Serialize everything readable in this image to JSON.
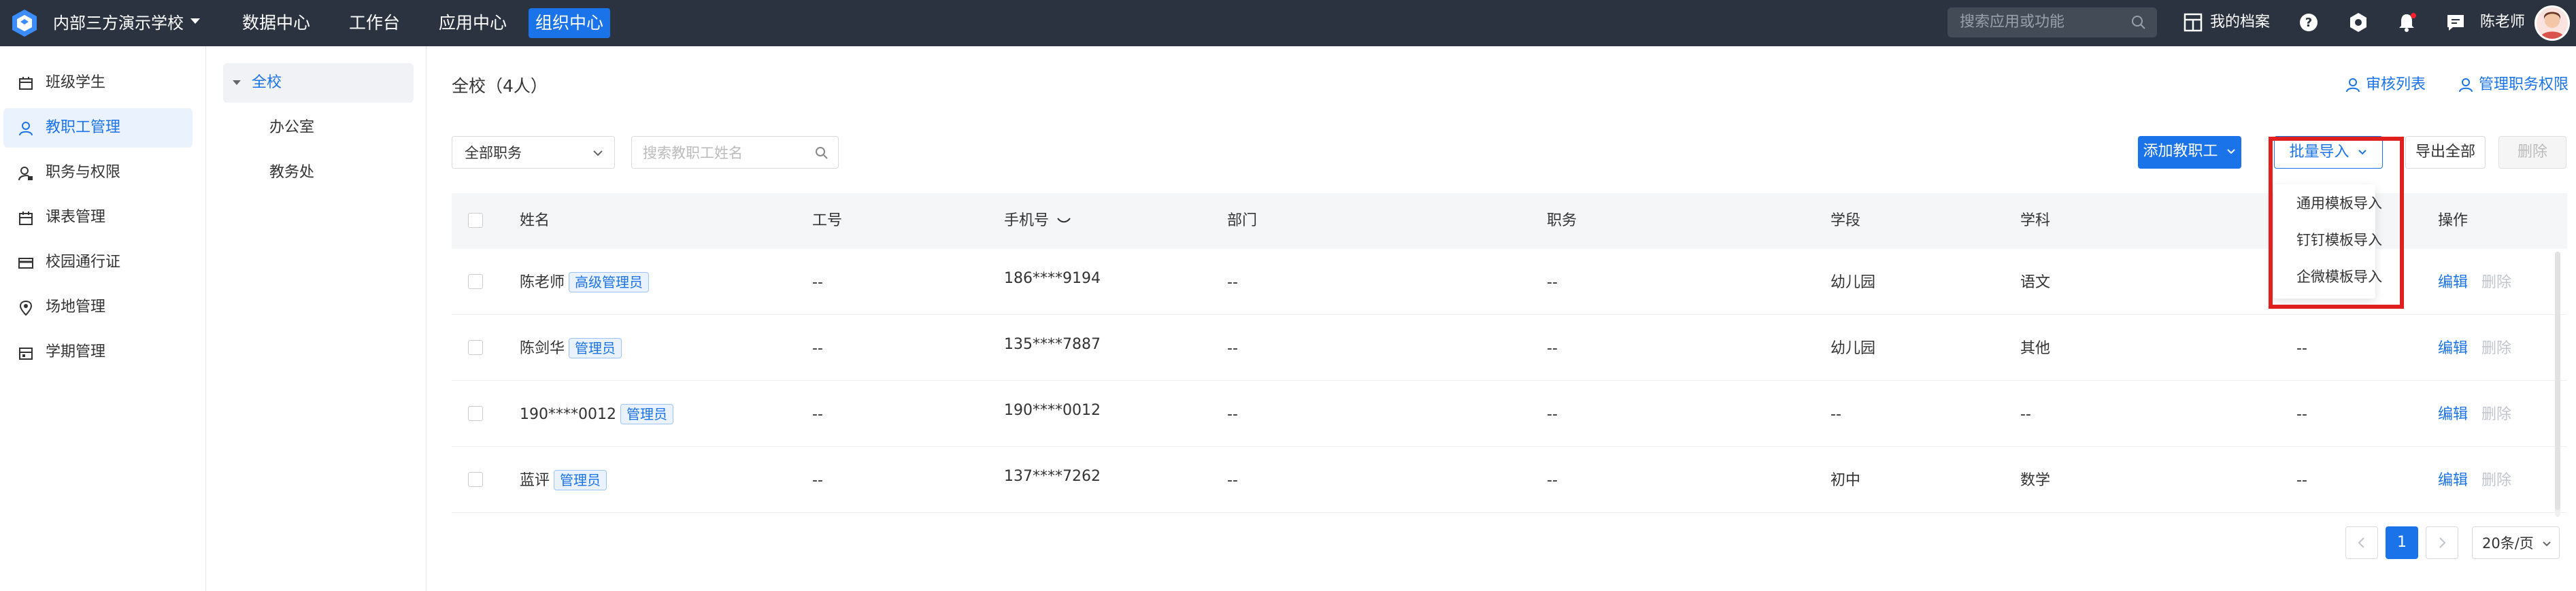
{
  "topbar": {
    "school_name": "内部三方演示学校",
    "nav": [
      "数据中心",
      "工作台",
      "应用中心",
      "组织中心"
    ],
    "search_placeholder": "搜索应用或功能",
    "my_profile": "我的档案",
    "user_name": "陈老师"
  },
  "sidebar": {
    "items": [
      {
        "label": "班级学生",
        "icon": "class-icon"
      },
      {
        "label": "教职工管理",
        "icon": "user-icon"
      },
      {
        "label": "职务与权限",
        "icon": "user-lock-icon"
      },
      {
        "label": "课表管理",
        "icon": "calendar-icon"
      },
      {
        "label": "校园通行证",
        "icon": "card-icon"
      },
      {
        "label": "场地管理",
        "icon": "location-icon"
      },
      {
        "label": "学期管理",
        "icon": "semester-icon"
      }
    ]
  },
  "tree": {
    "root": "全校",
    "children": [
      "办公室",
      "教务处"
    ]
  },
  "main": {
    "title": "全校（4人）",
    "review_list": "审核列表",
    "manage_permission": "管理职务权限",
    "role_filter": "全部职务",
    "search_placeholder": "搜索教职工姓名",
    "add_button": "添加教职工",
    "batch_import": "批量导入",
    "export_all": "导出全部",
    "delete": "删除"
  },
  "import_menu": [
    "通用模板导入",
    "钉钉模板导入",
    "企微模板导入"
  ],
  "table": {
    "columns": [
      "姓名",
      "工号",
      "手机号",
      "部门",
      "职务",
      "学段",
      "学科",
      "操作"
    ],
    "rows": [
      {
        "name": "陈老师",
        "tag": "高级管理员",
        "id": "--",
        "phone": "186****9194",
        "dept": "--",
        "position": "--",
        "stage": "幼儿园",
        "subject": "语文",
        "extra": "",
        "edit": "编辑",
        "del": "删除"
      },
      {
        "name": "陈剑华",
        "tag": "管理员",
        "id": "--",
        "phone": "135****7887",
        "dept": "--",
        "position": "--",
        "stage": "幼儿园",
        "subject": "其他",
        "extra": "--",
        "edit": "编辑",
        "del": "删除"
      },
      {
        "name": "190****0012",
        "tag": "管理员",
        "id": "--",
        "phone": "190****0012",
        "dept": "--",
        "position": "--",
        "stage": "--",
        "subject": "--",
        "extra": "--",
        "edit": "编辑",
        "del": "删除"
      },
      {
        "name": "蓝评",
        "tag": "管理员",
        "id": "--",
        "phone": "137****7262",
        "dept": "--",
        "position": "--",
        "stage": "初中",
        "subject": "数学",
        "extra": "--",
        "edit": "编辑",
        "del": "删除"
      }
    ]
  },
  "pagination": {
    "current": "1",
    "page_size": "20条/页"
  },
  "colors": {
    "topbar": "#2b3340",
    "accent": "#1a73e8",
    "highlight_box": "#e0201e"
  }
}
